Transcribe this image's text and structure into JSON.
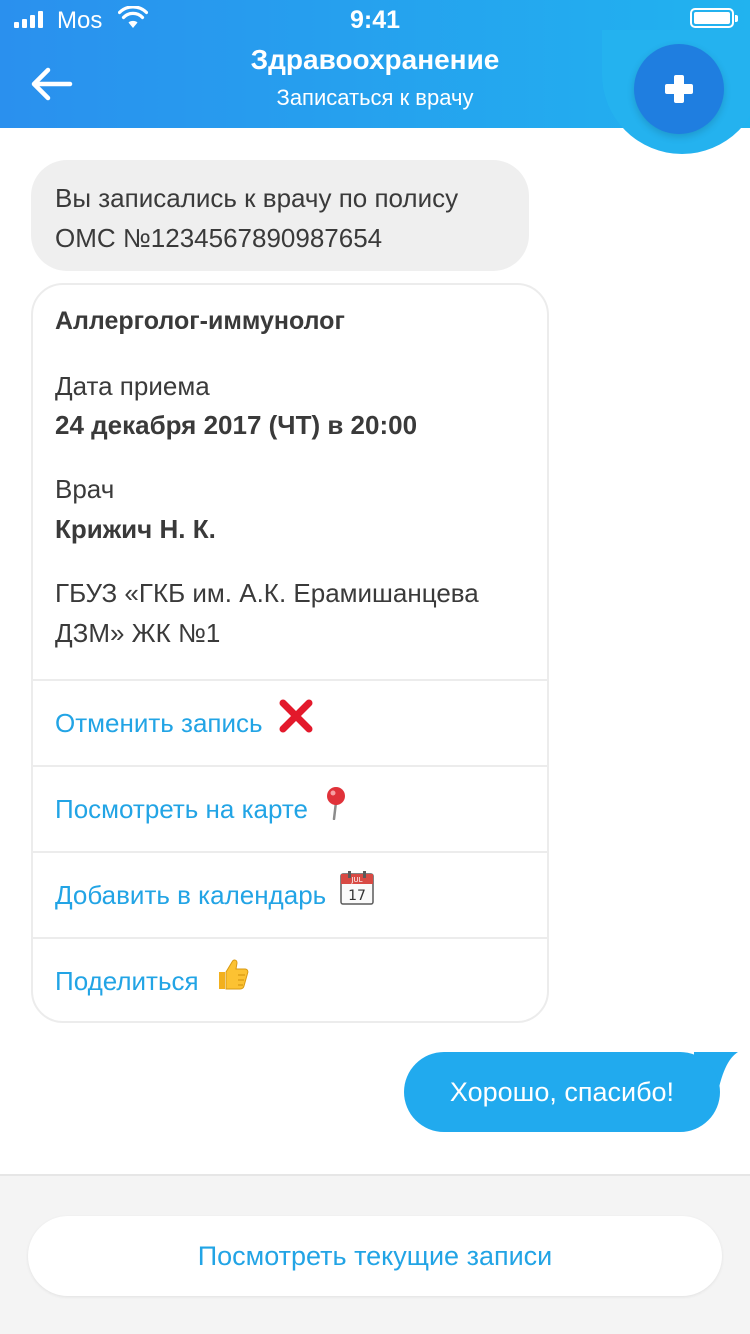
{
  "status_bar": {
    "carrier": "Mos",
    "time": "9:41",
    "icons": [
      "signal-icon",
      "wifi-icon",
      "battery-icon"
    ]
  },
  "header": {
    "title": "Здравоохранение",
    "subtitle": "Записаться к врачу",
    "back_icon": "arrow-left-icon",
    "plus_icon": "plus-icon",
    "colors": {
      "gradient_start": "#2a90ee",
      "gradient_end": "#21b3ef",
      "plus_button": "#1f7ee0"
    }
  },
  "messages": {
    "incoming": {
      "line1": "Вы записались к врачу по полису",
      "line2": "ОМС №1234567890987654"
    },
    "appointment": {
      "specialty": "Аллерголог-иммунолог",
      "date_label": "Дата приема",
      "date_value": "24 декабря 2017  (ЧТ) в 20:00",
      "doctor_label": "Врач",
      "doctor_value": "Крижич Н. К.",
      "clinic_line1": "ГБУЗ «ГКБ им. А.К. Ерамишанцева",
      "clinic_line2": "ДЗМ» ЖК №1",
      "actions": [
        {
          "label": "Отменить запись",
          "icon": "cross-mark-icon"
        },
        {
          "label": "Посмотреть на карте",
          "icon": "pushpin-icon"
        },
        {
          "label": "Добавить в календарь",
          "icon": "calendar-icon"
        },
        {
          "label": "Поделиться",
          "icon": "thumbs-up-icon"
        }
      ],
      "calendar_icon_text": {
        "month": "JUL",
        "day": "17"
      }
    },
    "outgoing": {
      "text": "Хорошо, спасибо!"
    }
  },
  "bottom": {
    "button_label": "Посмотреть текущие записи"
  },
  "colors": {
    "accent": "#22a4e5",
    "bubble_in": "#efefef",
    "bubble_out": "#21aaee",
    "text": "#3a3a3a"
  }
}
